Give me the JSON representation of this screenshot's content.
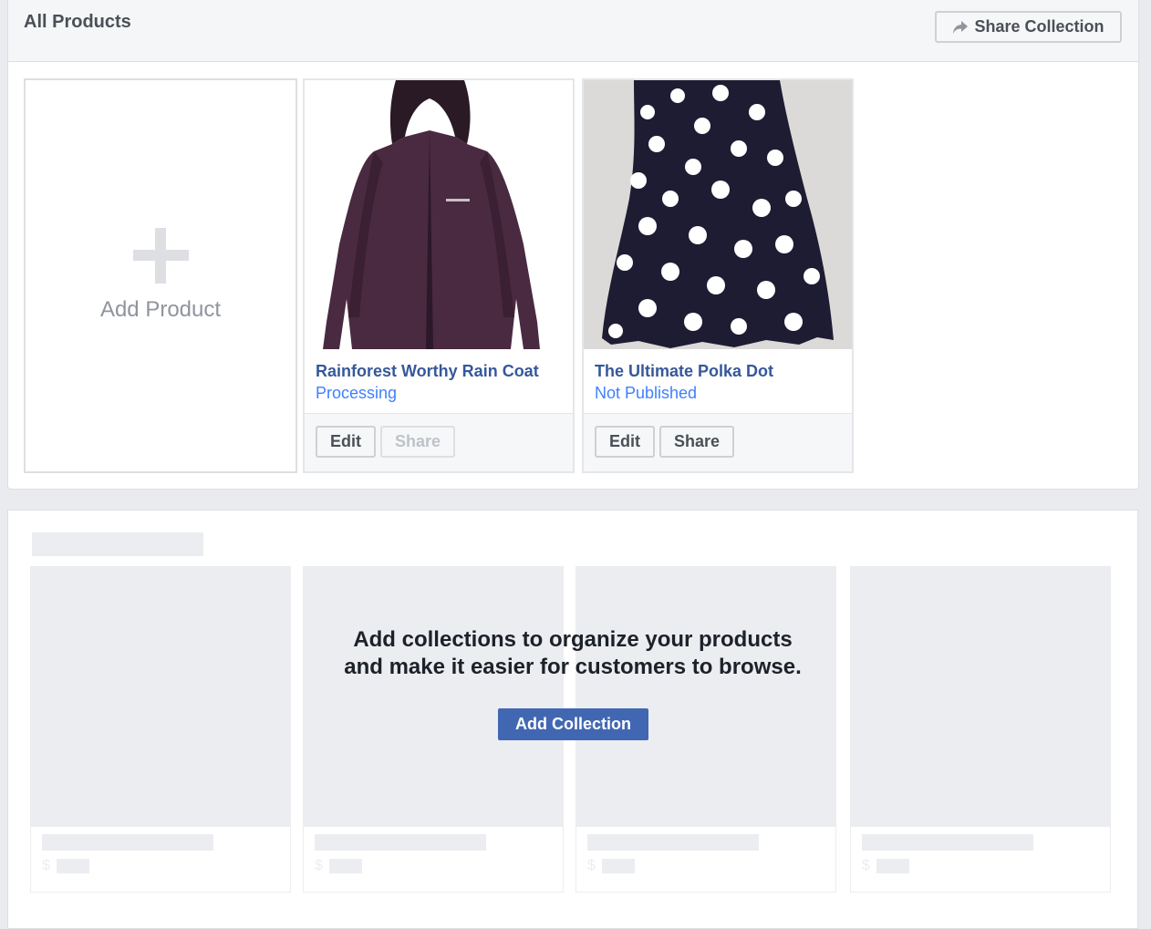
{
  "header": {
    "title": "All Products",
    "share_collection_label": "Share Collection",
    "share_icon": "share-arrow-icon"
  },
  "add_product": {
    "label": "Add Product",
    "icon": "plus-icon"
  },
  "products": [
    {
      "name": "Rainforest Worthy Rain Coat",
      "status": "Processing",
      "edit_label": "Edit",
      "share_label": "Share",
      "share_enabled": false
    },
    {
      "name": "The Ultimate Polka Dot",
      "status": "Not Published",
      "edit_label": "Edit",
      "share_label": "Share",
      "share_enabled": true
    }
  ],
  "collections": {
    "message_line1": "Add collections to organize your products",
    "message_line2": "and make it easier for customers to browse.",
    "add_collection_label": "Add Collection",
    "placeholder_currency": "$"
  },
  "colors": {
    "link": "#365899",
    "status": "#4080ff",
    "primary_button": "#4267b2",
    "background": "#e9ebee"
  }
}
